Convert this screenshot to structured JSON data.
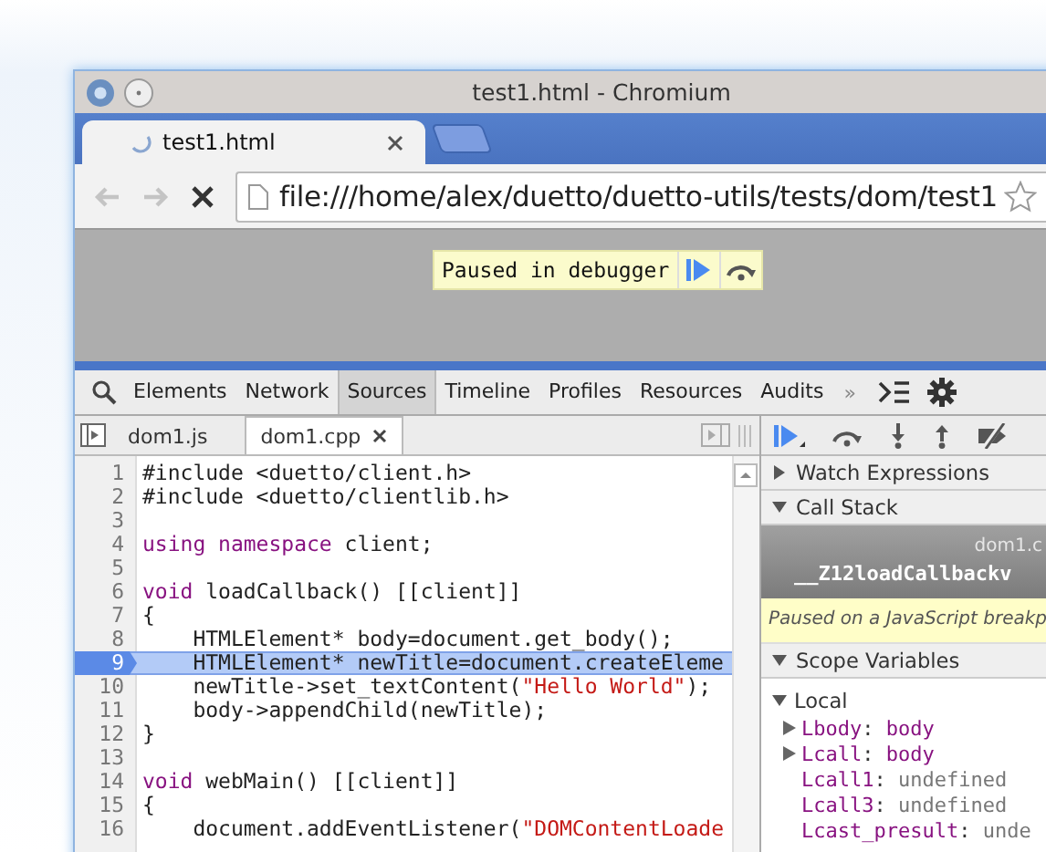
{
  "window": {
    "title": "test1.html - Chromium"
  },
  "browser_tabs": [
    {
      "label": "test1.html",
      "selected": true,
      "loading": true
    }
  ],
  "nav_buttons": [
    {
      "kind": "back",
      "disabled": true
    },
    {
      "kind": "forward",
      "disabled": true
    },
    {
      "kind": "stop",
      "disabled": false
    }
  ],
  "address_bar": {
    "value": "file:///home/alex/duetto/duetto-utils/tests/dom/test1"
  },
  "paused_banner": {
    "text": "Paused in debugger"
  },
  "devtools": {
    "panels": [
      {
        "label": "Elements",
        "selected": false
      },
      {
        "label": "Network",
        "selected": false
      },
      {
        "label": "Sources",
        "selected": true
      },
      {
        "label": "Timeline",
        "selected": false
      },
      {
        "label": "Profiles",
        "selected": false
      },
      {
        "label": "Resources",
        "selected": false
      },
      {
        "label": "Audits",
        "selected": false
      }
    ],
    "overflow": "»",
    "files": [
      {
        "name": "dom1.js",
        "selected": false,
        "closable": false
      },
      {
        "name": "dom1.cpp",
        "selected": true,
        "closable": true
      }
    ],
    "code_lines": [
      {
        "number": "1",
        "current": false,
        "tokens": [
          {
            "kind": "plain",
            "text": "#include <duetto/client.h>"
          }
        ]
      },
      {
        "number": "2",
        "current": false,
        "tokens": [
          {
            "kind": "plain",
            "text": "#include <duetto/clientlib.h>"
          }
        ]
      },
      {
        "number": "3",
        "current": false
      },
      {
        "number": "4",
        "current": false,
        "tokens": [
          {
            "kind": "keyword",
            "text": "using namespace"
          },
          {
            "kind": "plain",
            "text": " client;"
          }
        ]
      },
      {
        "number": "5",
        "current": false
      },
      {
        "number": "6",
        "current": false,
        "tokens": [
          {
            "kind": "keyword",
            "text": "void"
          },
          {
            "kind": "plain",
            "text": " loadCallback() [[client]]"
          }
        ]
      },
      {
        "number": "7",
        "current": false,
        "tokens": [
          {
            "kind": "plain",
            "text": "{"
          }
        ]
      },
      {
        "number": "8",
        "current": false,
        "tokens": [
          {
            "kind": "plain",
            "text": "    HTMLElement* body=document.get_body();"
          }
        ]
      },
      {
        "number": "9",
        "current": true,
        "tokens": [
          {
            "kind": "plain",
            "text": "    HTMLElement* newTitle=document.createEleme"
          }
        ]
      },
      {
        "number": "10",
        "current": false,
        "tokens": [
          {
            "kind": "plain",
            "text": "    newTitle->set_textContent("
          },
          {
            "kind": "string",
            "text": "\"Hello World\""
          },
          {
            "kind": "plain",
            "text": ");"
          }
        ]
      },
      {
        "number": "11",
        "current": false,
        "tokens": [
          {
            "kind": "plain",
            "text": "    body->appendChild(newTitle);"
          }
        ]
      },
      {
        "number": "12",
        "current": false,
        "tokens": [
          {
            "kind": "plain",
            "text": "}"
          }
        ]
      },
      {
        "number": "13",
        "current": false
      },
      {
        "number": "14",
        "current": false,
        "tokens": [
          {
            "kind": "keyword",
            "text": "void"
          },
          {
            "kind": "plain",
            "text": " webMain() [[client]]"
          }
        ]
      },
      {
        "number": "15",
        "current": false,
        "tokens": [
          {
            "kind": "plain",
            "text": "{"
          }
        ]
      },
      {
        "number": "16",
        "current": false,
        "tokens": [
          {
            "kind": "plain",
            "text": "    document.addEventListener("
          },
          {
            "kind": "string",
            "text": "\"DOMContentLoade"
          }
        ]
      }
    ],
    "watch": {
      "title": "Watch Expressions",
      "expanded": false
    },
    "call_stack": {
      "title": "Call Stack",
      "expanded": true,
      "frames": [
        {
          "name": "__Z12loadCallbackv",
          "location": "dom1.c",
          "selected": true
        }
      ],
      "message": "Paused on a JavaScript breakp"
    },
    "scope": {
      "title": "Scope Variables",
      "expanded": true,
      "scopes": [
        {
          "title": "Local",
          "expanded": true,
          "variables": [
            {
              "name": "Lbody",
              "separator": ":",
              "value": "body",
              "kind": "object"
            },
            {
              "name": "Lcall",
              "separator": ":",
              "value": "body",
              "kind": "object"
            },
            {
              "name": "Lcall1",
              "separator": ":",
              "value": "undefined",
              "kind": "primitive"
            },
            {
              "name": "Lcall3",
              "separator": ":",
              "value": "undefined",
              "kind": "primitive"
            },
            {
              "name": "Lcast_presult",
              "separator": ":",
              "value": "unde",
              "kind": "primitive"
            }
          ]
        }
      ]
    }
  }
}
